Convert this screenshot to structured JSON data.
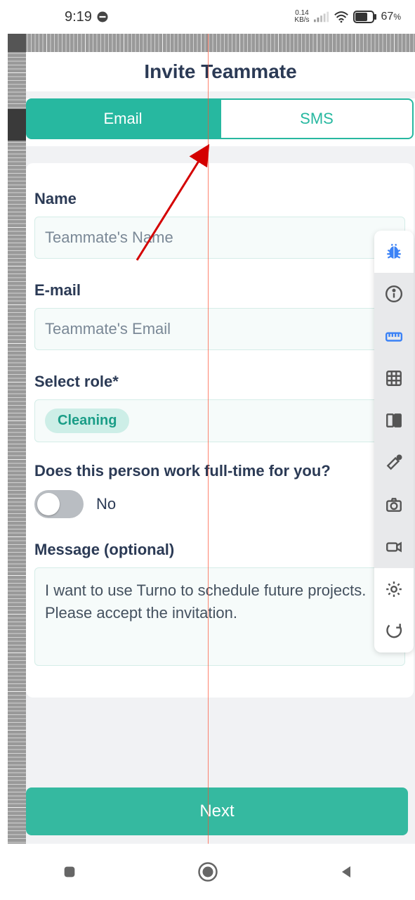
{
  "status": {
    "time": "9:19",
    "net_speed_top": "0.14",
    "net_speed_unit": "KB/s",
    "battery": "67",
    "battery_unit": "%"
  },
  "header": {
    "title": "Invite Teammate"
  },
  "tabs": {
    "email": "Email",
    "sms": "SMS"
  },
  "form": {
    "name_label": "Name",
    "name_placeholder": "Teammate's Name",
    "email_label": "E-mail",
    "email_placeholder": "Teammate's Email",
    "role_label": "Select role*",
    "role_value": "Cleaning",
    "fulltime_question": "Does this person work full-time for you?",
    "fulltime_value": "No",
    "message_label": "Message (optional)",
    "message_value": "I want to use Turno to schedule future projects. Please accept the invitation."
  },
  "footer": {
    "next": "Next"
  },
  "tools": [
    {
      "name": "bug",
      "color": "blue",
      "bg": "white"
    },
    {
      "name": "info",
      "color": "gray",
      "bg": "gray"
    },
    {
      "name": "ruler",
      "color": "blue",
      "bg": "gray"
    },
    {
      "name": "grid",
      "color": "gray",
      "bg": "gray"
    },
    {
      "name": "split",
      "color": "gray",
      "bg": "gray"
    },
    {
      "name": "dropper",
      "color": "gray",
      "bg": "gray"
    },
    {
      "name": "camera",
      "color": "gray",
      "bg": "gray"
    },
    {
      "name": "video",
      "color": "gray",
      "bg": "gray"
    },
    {
      "name": "settings",
      "color": "gray",
      "bg": "white"
    },
    {
      "name": "refresh",
      "color": "gray",
      "bg": "white"
    }
  ]
}
